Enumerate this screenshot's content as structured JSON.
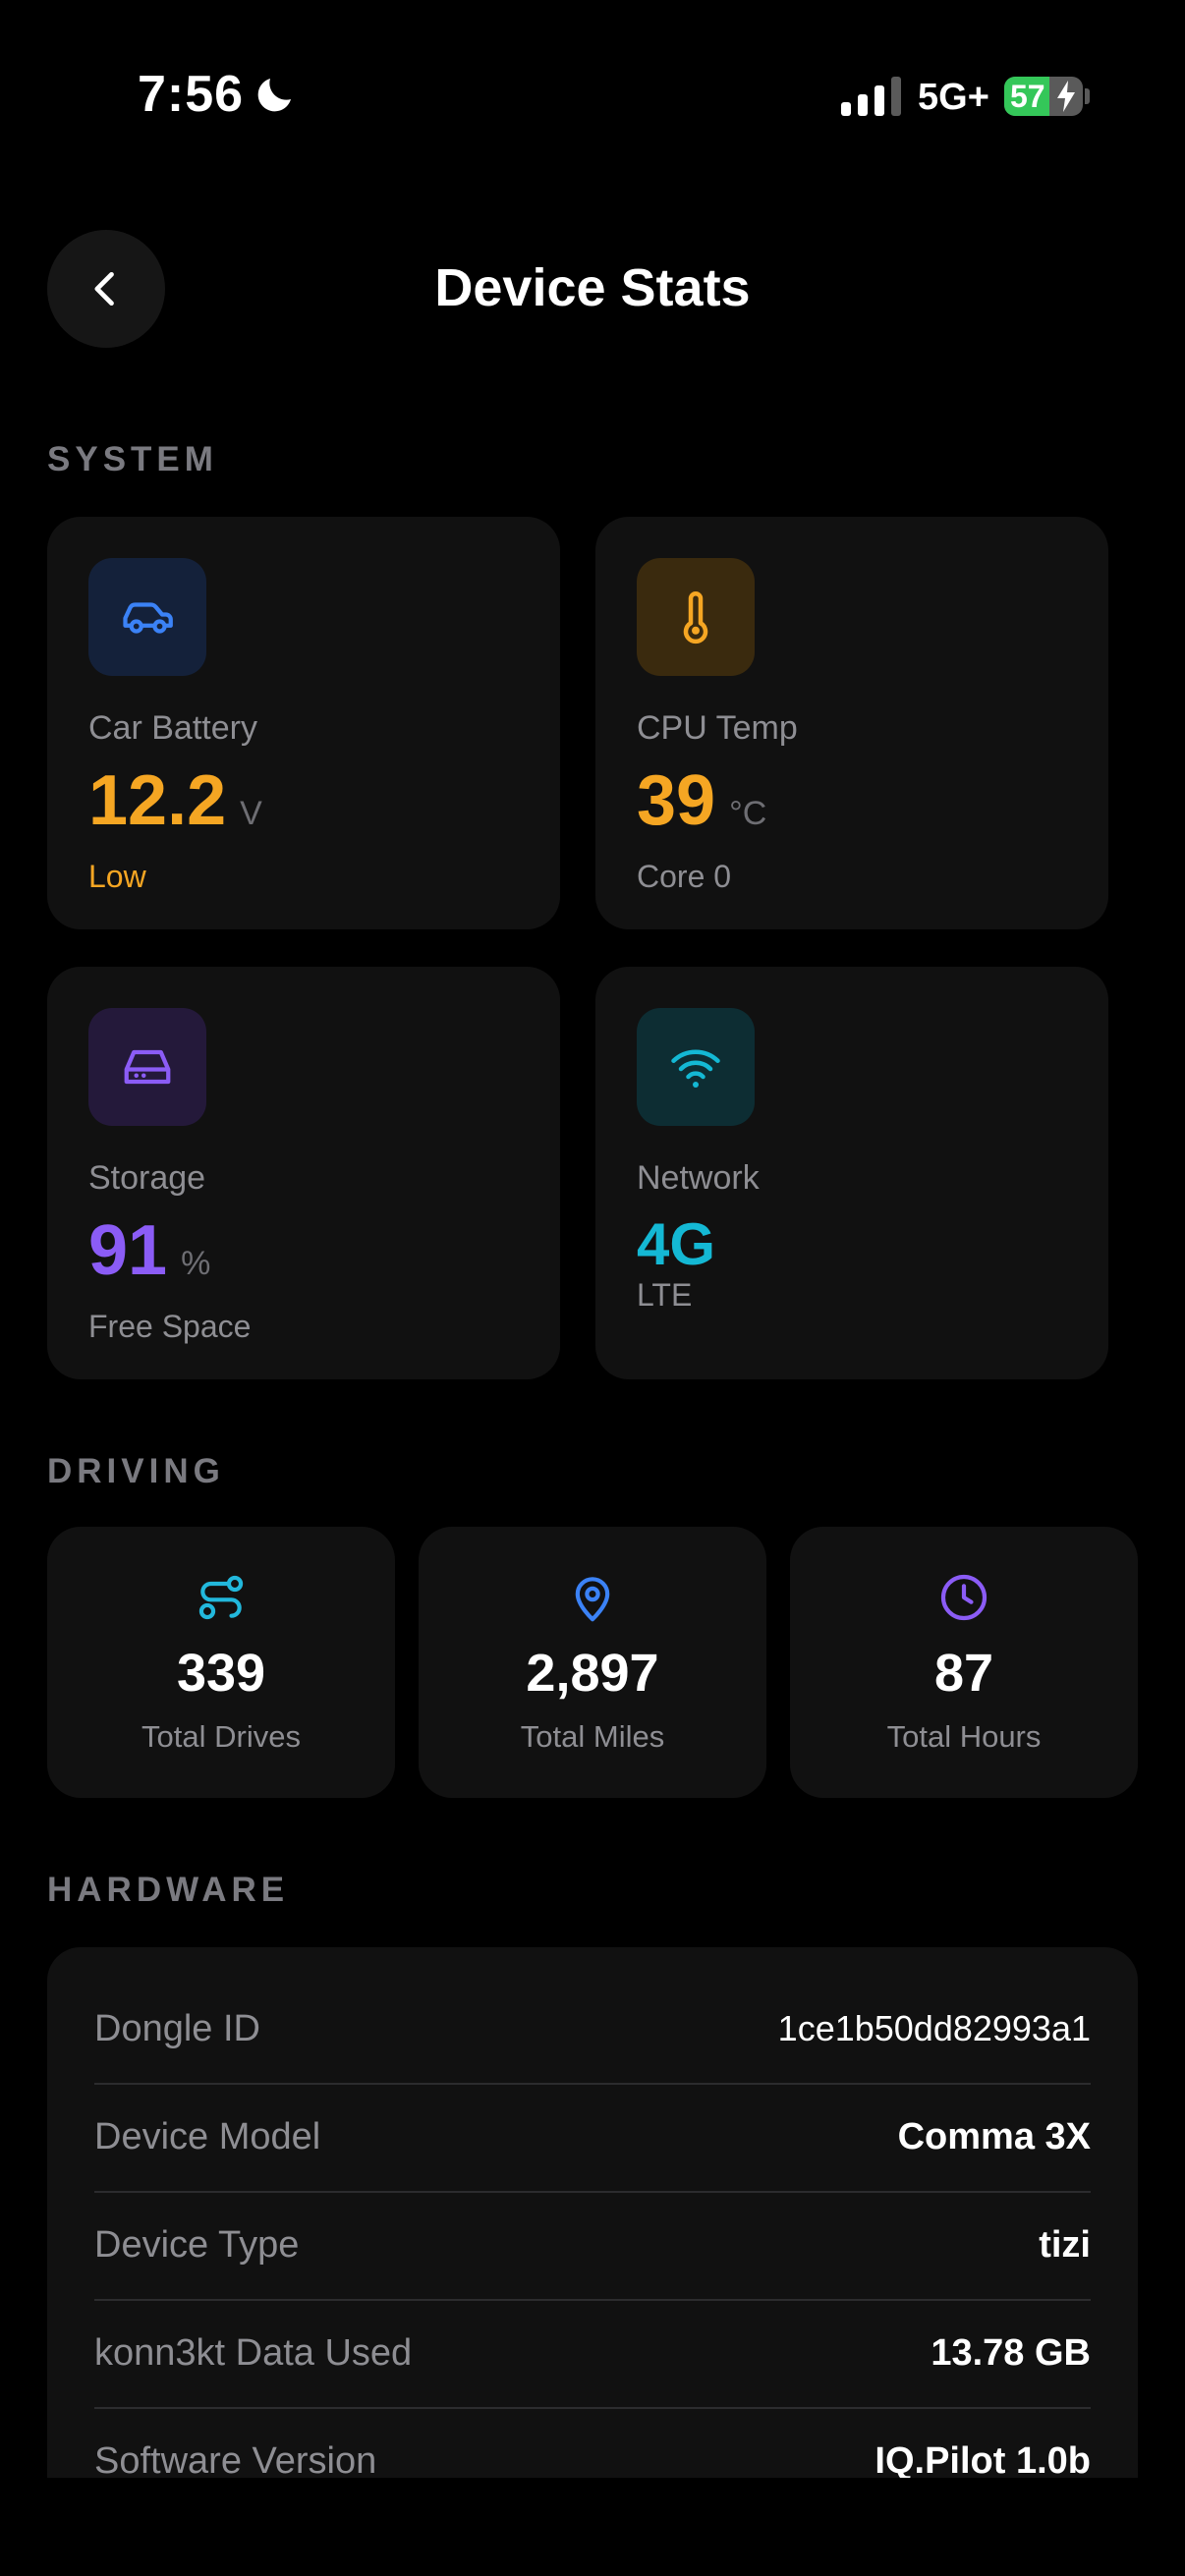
{
  "status_bar": {
    "time": "7:56",
    "network": "5G+",
    "battery_percent": "57",
    "battery_level": 0.57,
    "icons": [
      "moon-icon",
      "signal-icon",
      "battery-charging-icon"
    ]
  },
  "header": {
    "title": "Device Stats",
    "back_icon": "chevron-left-icon"
  },
  "sections": {
    "system": "SYSTEM",
    "driving": "DRIVING",
    "hardware": "HARDWARE"
  },
  "system": {
    "car_battery": {
      "label": "Car Battery",
      "value": "12.2",
      "unit": "V",
      "sub": "Low",
      "icon": "car-icon",
      "color": "#f5a623"
    },
    "cpu_temp": {
      "label": "CPU Temp",
      "value": "39",
      "unit": "°C",
      "sub": "Core 0",
      "icon": "thermometer-icon",
      "color": "#f5a623"
    },
    "storage": {
      "label": "Storage",
      "value": "91",
      "unit": "%",
      "sub": "Free Space",
      "icon": "hard-drive-icon",
      "color": "#8b5cf6"
    },
    "network": {
      "label": "Network",
      "value": "4G",
      "sub": "LTE",
      "icon": "wifi-icon",
      "color": "#14b8d4"
    }
  },
  "driving": {
    "drives": {
      "value": "339",
      "label": "Total Drives",
      "icon": "route-icon",
      "color": "#22b8dc"
    },
    "miles": {
      "value": "2,897",
      "label": "Total Miles",
      "icon": "map-pin-icon",
      "color": "#3b82f6"
    },
    "hours": {
      "value": "87",
      "label": "Total Hours",
      "icon": "clock-icon",
      "color": "#8b5cf6"
    }
  },
  "hardware": {
    "rows": [
      {
        "key": "Dongle ID",
        "value": "1ce1b50dd82993a1"
      },
      {
        "key": "Device Model",
        "value": "Comma 3X"
      },
      {
        "key": "Device Type",
        "value": "tizi"
      },
      {
        "key": "konn3kt Data Used",
        "value": "13.78 GB"
      },
      {
        "key": "Software Version",
        "value": "IQ.Pilot 1.0b"
      }
    ]
  }
}
